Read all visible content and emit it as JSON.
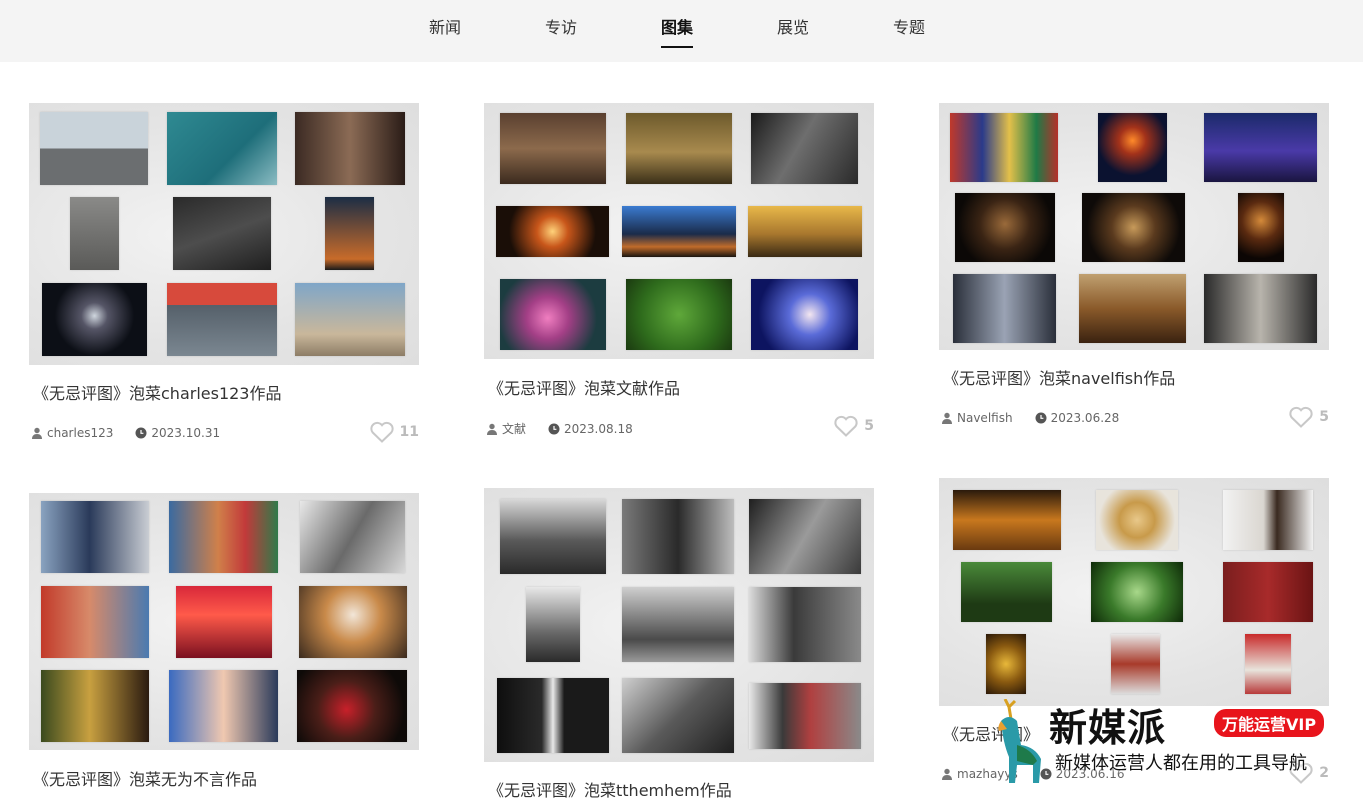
{
  "nav": {
    "tabs": [
      {
        "label": "新闻"
      },
      {
        "label": "专访"
      },
      {
        "label": "图集"
      },
      {
        "label": "展览"
      },
      {
        "label": "专题"
      }
    ],
    "active_tab": "图集"
  },
  "cards": [
    {
      "title": "《无忌评图》泡菜charles123作品",
      "author": "charles123",
      "date": "2023.10.31",
      "likes": "11"
    },
    {
      "title": "《无忌评图》泡菜文献作品",
      "author": "文献",
      "date": "2023.08.18",
      "likes": "5"
    },
    {
      "title": "《无忌评图》泡菜navelfish作品",
      "author": "Navelfish",
      "date": "2023.06.28",
      "likes": "5"
    },
    {
      "title": "《无忌评图》泡菜无为不言作品",
      "author": "",
      "date": "",
      "likes": ""
    },
    {
      "title": "《无忌评图》泡菜tthemhem作品",
      "author": "",
      "date": "",
      "likes": ""
    },
    {
      "title": "《无忌评图》",
      "author": "mazhayys",
      "date": "2023.06.16",
      "likes": "2"
    }
  ],
  "watermark": {
    "brand": "新媒派",
    "badge": "万能运营VIP",
    "slogan": "新媒体运营人都在用的工具导航"
  },
  "colors": {
    "nav_bg": "#f4f4f4",
    "like_icon": "#bbbbbb",
    "badge_red": "#e8141c"
  }
}
